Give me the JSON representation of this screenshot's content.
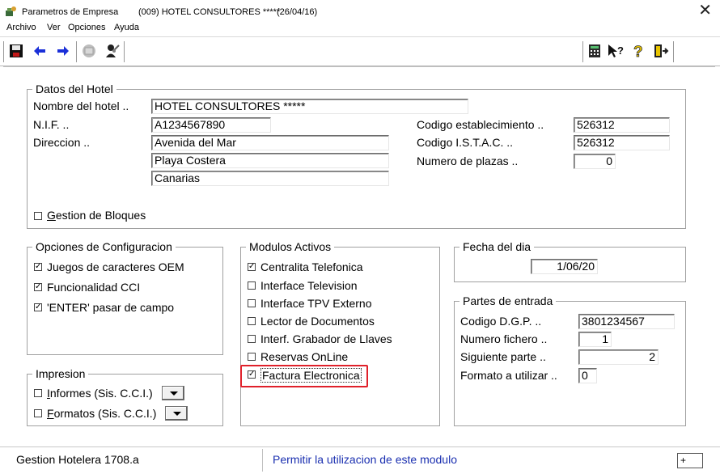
{
  "window": {
    "title": "Parametros de Empresa",
    "company": "(009) HOTEL CONSULTORES *****",
    "date": "(26/04/16)",
    "close_label": "✕"
  },
  "menu": {
    "items": [
      "Archivo",
      "Ver",
      "Opciones",
      "Ayuda"
    ]
  },
  "toolbar": {
    "icons": [
      "save-icon",
      "arrow-left-icon",
      "arrow-right-icon",
      "disabled-disk-icon",
      "user-key-icon",
      "calculator-icon",
      "help-pointer-icon",
      "question-icon",
      "exit-door-icon"
    ],
    "accent_blue": "#1a2fd8",
    "help_yellow": "#e8c400"
  },
  "hotel": {
    "legend": "Datos del Hotel",
    "name_label": "Nombre del hotel ..",
    "name_value": "HOTEL CONSULTORES *****",
    "nif_label": "N.I.F. ..",
    "nif_value": "A1234567890",
    "address_label": "Direccion ..",
    "address_1": "Avenida del Mar",
    "address_2": "Playa Costera",
    "address_3": "Canarias",
    "estab_label": "Codigo establecimiento ..",
    "estab_value": "526312",
    "istac_label": "Codigo I.S.T.A.C. ..",
    "istac_value": "526312",
    "plazas_label": "Numero de plazas ..",
    "plazas_value": "0",
    "bloques_prefix": "G",
    "bloques_label": "estion de Bloques",
    "bloques_checked": false
  },
  "config": {
    "legend": "Opciones de Configuracion",
    "options": [
      {
        "label": "Juegos de caracteres OEM",
        "checked": true
      },
      {
        "label": "Funcionalidad CCI",
        "checked": true
      },
      {
        "label": "'ENTER' pasar de campo",
        "checked": true
      }
    ]
  },
  "modules": {
    "legend": "Modulos Activos",
    "items": [
      {
        "label": "Centralita Telefonica",
        "checked": true
      },
      {
        "label": "Interface Television",
        "checked": false
      },
      {
        "label": "Interface TPV Externo",
        "checked": false
      },
      {
        "label": "Lector de Documentos",
        "checked": false
      },
      {
        "label": "Interf. Grabador de Llaves",
        "checked": false
      },
      {
        "label": "Reservas OnLine",
        "checked": false
      },
      {
        "label": "Factura Electronica",
        "checked": true
      }
    ],
    "highlight_color": "#e0202a"
  },
  "print": {
    "legend": "Impresion",
    "informes_prefix": "I",
    "informes_label": "nformes (Sis. C.C.I.)",
    "formatos_prefix": "F",
    "formatos_label": "ormatos (Sis. C.C.I.)"
  },
  "fecha": {
    "legend": "Fecha del dia",
    "value": "1/06/20"
  },
  "partes": {
    "legend": "Partes de entrada",
    "dgp_label": "Codigo D.G.P. ..",
    "dgp_value": "3801234567",
    "fichero_label": "Numero fichero ..",
    "fichero_value": "1",
    "siguiente_label": "Siguiente parte ..",
    "siguiente_value": "2",
    "formato_label": "Formato a utilizar ..",
    "formato_value": "0"
  },
  "status": {
    "left": "Gestion Hotelera 1708.a",
    "message": "Permitir la utilizacion de este modulo",
    "message_color": "#1a2fb0",
    "right": "+"
  }
}
